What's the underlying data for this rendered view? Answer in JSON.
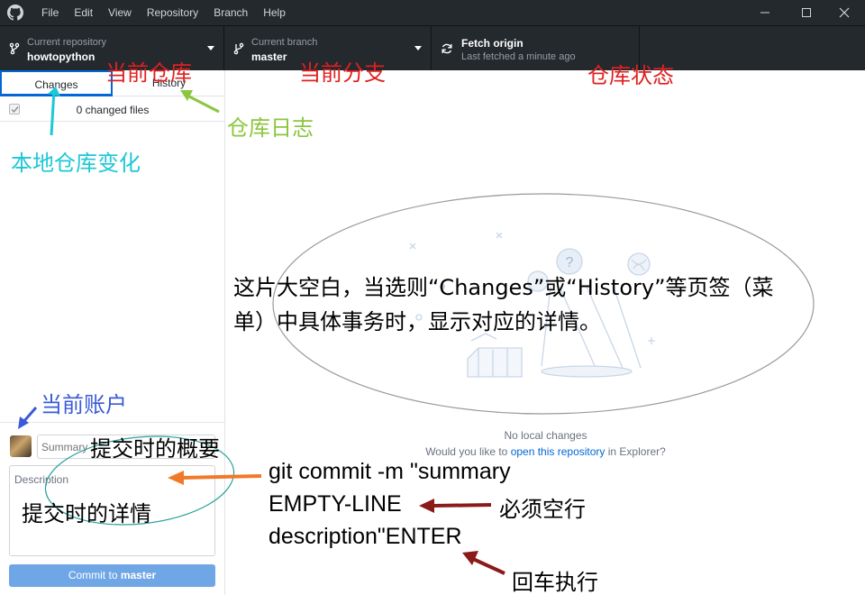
{
  "menu": {
    "items": [
      "File",
      "Edit",
      "View",
      "Repository",
      "Branch",
      "Help"
    ]
  },
  "toolbar": {
    "repository": {
      "small_label": "Current repository",
      "value": "howtopython"
    },
    "branch": {
      "small_label": "Current branch",
      "value": "master"
    },
    "fetch": {
      "label": "Fetch origin",
      "status": "Last fetched a minute ago"
    }
  },
  "sidebar": {
    "tabs": {
      "changes": "Changes",
      "history": "History"
    },
    "changed_files": "0 changed files",
    "summary_placeholder": "Summary",
    "description_placeholder": "Description",
    "commit_button": {
      "prefix": "Commit to ",
      "branch": "master"
    }
  },
  "main": {
    "no_changes": "No local changes",
    "prompt_before": "Would you like to ",
    "prompt_link": "open this repository",
    "prompt_after": " in Explorer?"
  },
  "annotations": {
    "current_repo": "当前仓库",
    "current_branch": "当前分支",
    "repo_status": "仓库状态",
    "repo_log": "仓库日志",
    "local_changes": "本地仓库变化",
    "blank_line1": "这片大空白，当选则“Changes”或“History”等页签（菜",
    "blank_line2": "单）中具体事务时，显示对应的详情。",
    "current_account": "当前账户",
    "commit_summary": "提交时的概要",
    "commit_detail": "提交时的详情",
    "git_line1": "git commit -m \"summary",
    "git_line2": "EMPTY-LINE",
    "git_line3": "description\"ENTER",
    "must_empty": "必须空行",
    "enter_exec": "回车执行"
  },
  "colors": {
    "titlebar": "#24292e",
    "accent": "#0366d6",
    "commit_button": "#6ea6e6",
    "annotation_red": "#e02020",
    "annotation_green": "#8cc63f",
    "annotation_cyan": "#1dc7d6",
    "annotation_blue": "#3a5bd8",
    "arrow_orange": "#f07a2a",
    "arrow_darkred": "#8b1a1a"
  }
}
